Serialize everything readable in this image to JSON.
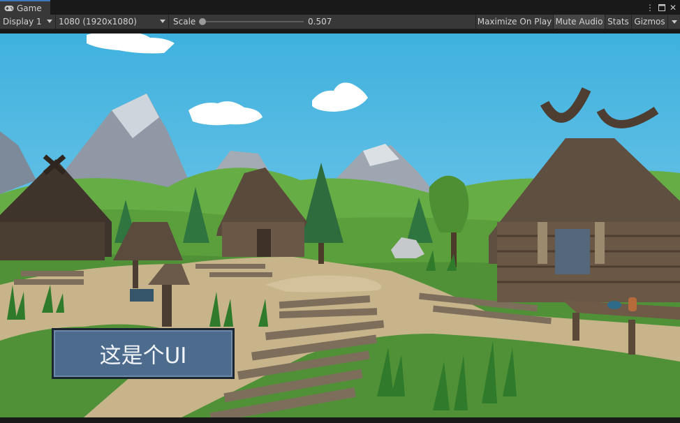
{
  "tab": {
    "title": "Game",
    "icon": "gamepad-icon"
  },
  "tab_controls": {
    "more_icon": "kebab-menu-icon",
    "maximize_icon": "maximize-icon",
    "close_icon": "close-icon"
  },
  "toolbar": {
    "display": "Display 1",
    "resolution": "1080 (1920x1080)",
    "scale_label": "Scale",
    "scale_value": "0.507",
    "scale_fraction": 0.0,
    "maximize_on_play": "Maximize On Play",
    "mute_audio": "Mute Audio",
    "stats": "Stats",
    "gizmos": "Gizmos"
  },
  "game_ui": {
    "button_text": "这是个UI"
  },
  "colors": {
    "accent": "#3a79bb",
    "sky": "#4bbbe3",
    "grass": "#5aa33e",
    "button": "#4d6b8c"
  }
}
